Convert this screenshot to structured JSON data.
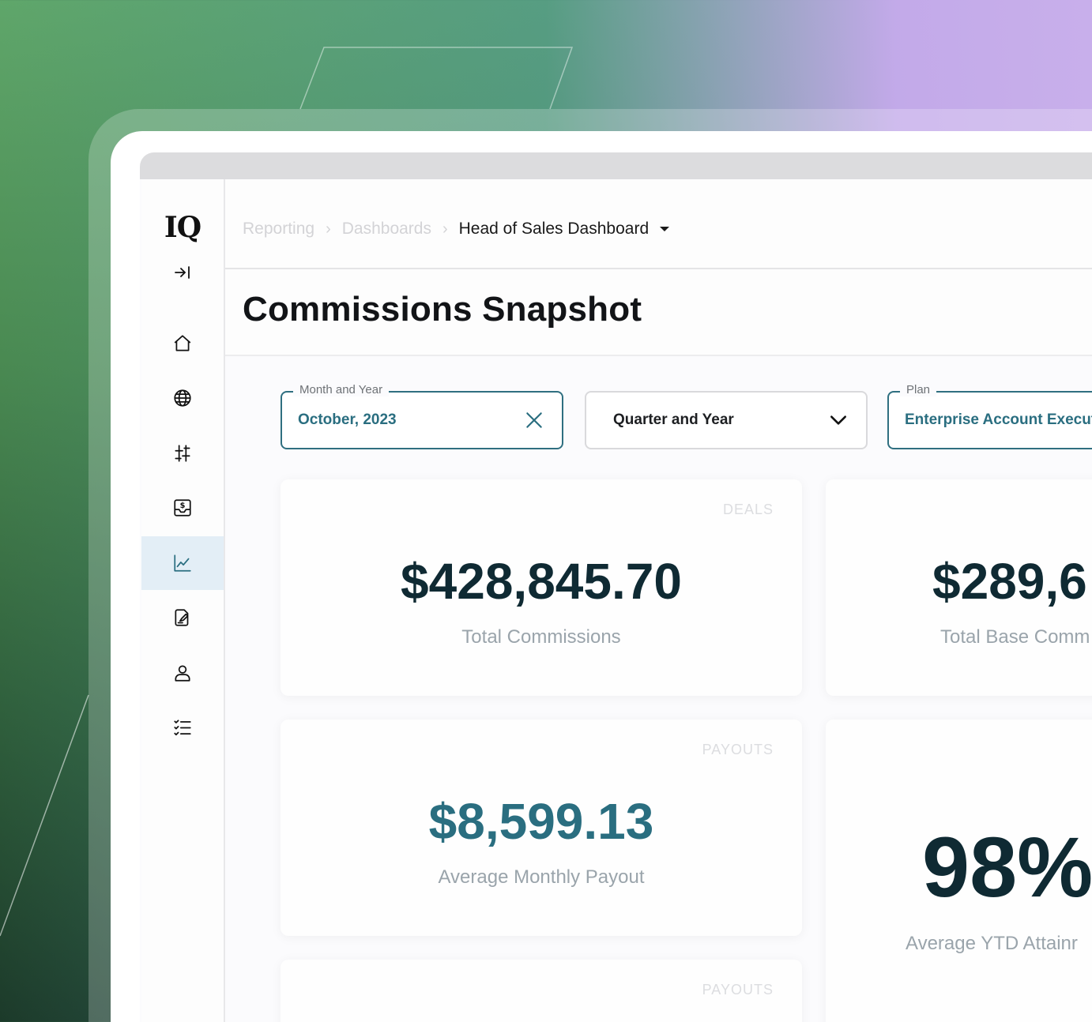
{
  "app": {
    "logo_text": "IQ"
  },
  "sidebar": {
    "items": [
      {
        "name": "home",
        "icon": "home-icon",
        "active": false
      },
      {
        "name": "globe",
        "icon": "globe-icon",
        "active": false
      },
      {
        "name": "adjust",
        "icon": "sliders-icon",
        "active": false
      },
      {
        "name": "payments",
        "icon": "dollar-inbox-icon",
        "active": false
      },
      {
        "name": "reporting",
        "icon": "line-chart-icon",
        "active": true
      },
      {
        "name": "documents",
        "icon": "edit-document-icon",
        "active": false
      },
      {
        "name": "people",
        "icon": "user-icon",
        "active": false
      },
      {
        "name": "tasks",
        "icon": "checklist-icon",
        "active": false
      }
    ]
  },
  "breadcrumb": {
    "items": [
      "Reporting",
      "Dashboards"
    ],
    "current": "Head of Sales Dashboard"
  },
  "page": {
    "title": "Commissions Snapshot"
  },
  "filters": {
    "month": {
      "legend": "Month and Year",
      "value": "October, 2023"
    },
    "quarter": {
      "placeholder": "Quarter and Year"
    },
    "plan": {
      "legend": "Plan",
      "value": "Enterprise Account Executi"
    }
  },
  "cards": [
    {
      "tag": "DEALS",
      "value": "$428,845.70",
      "label": "Total Commissions"
    },
    {
      "tag": "",
      "value": "$289,6",
      "label": "Total Base Comm"
    },
    {
      "tag": "PAYOUTS",
      "value": "$8,599.13",
      "label": "Average Monthly Payout"
    },
    {
      "tag": "",
      "value": "98%",
      "label": "Average YTD Attainr"
    },
    {
      "tag": "PAYOUTS",
      "value": "",
      "label": ""
    }
  ],
  "colors": {
    "accent_teal": "#2a6e80",
    "dark_value": "#0f2a33",
    "active_nav_bg": "#e3eef6"
  }
}
